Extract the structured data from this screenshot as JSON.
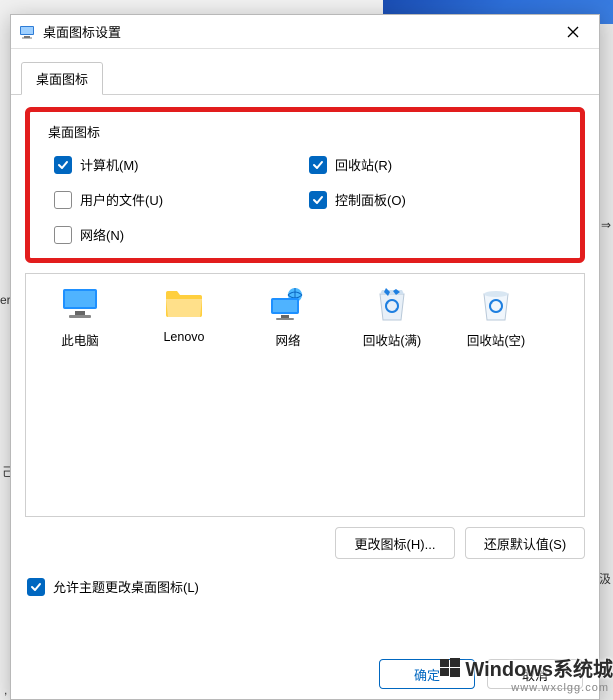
{
  "window": {
    "title": "桌面图标设置"
  },
  "tab": {
    "label": "桌面图标"
  },
  "group": {
    "title": "桌面图标"
  },
  "checkboxes": {
    "computer": {
      "label": "计算机(M)",
      "checked": true
    },
    "recycle": {
      "label": "回收站(R)",
      "checked": true
    },
    "userfiles": {
      "label": "用户的文件(U)",
      "checked": false
    },
    "control": {
      "label": "控制面板(O)",
      "checked": true
    },
    "network": {
      "label": "网络(N)",
      "checked": false
    }
  },
  "icons": {
    "this_pc": "此电脑",
    "lenovo": "Lenovo",
    "network": "网络",
    "recycle_full": "回收站(满)",
    "recycle_empty": "回收站(空)"
  },
  "buttons": {
    "change_icon": "更改图标(H)...",
    "restore_default": "还原默认值(S)",
    "ok": "确定",
    "cancel": "取消"
  },
  "theme_checkbox": {
    "label": "允许主题更改桌面图标(L)",
    "checked": true
  },
  "watermark": {
    "main": "Windows系统城",
    "sub": "www.wxclgg.com"
  },
  "side_hints": {
    "h1": "⇒",
    "h2": "er",
    "h3": "汲",
    "h4": "己",
    "h5": ","
  }
}
